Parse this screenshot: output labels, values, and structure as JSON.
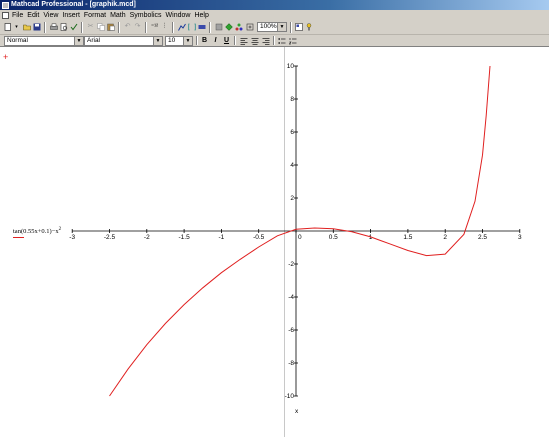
{
  "window": {
    "title": "Mathcad Professional - [graphik.mcd]"
  },
  "menu": {
    "items": [
      "File",
      "Edit",
      "View",
      "Insert",
      "Format",
      "Math",
      "Symbolics",
      "Window",
      "Help"
    ]
  },
  "toolbar": {
    "zoom": "100%"
  },
  "format_bar": {
    "style": "Normal",
    "font": "Arial",
    "size": "10",
    "bold": "B",
    "italic": "I",
    "underline": "U"
  },
  "plot": {
    "legend": "tan(0.55x+0.1)−x",
    "legend_exp": "2",
    "axis_var": "x",
    "x_ticks": [
      "-3",
      "-2.5",
      "-2",
      "-1.5",
      "-1",
      "-0.5",
      "0",
      "0.5",
      "1",
      "1.5",
      "2",
      "2.5",
      "3"
    ],
    "y_ticks": [
      "10",
      "8",
      "6",
      "4",
      "2",
      "-2",
      "-4",
      "-6",
      "-8",
      "-10"
    ],
    "curve_color": "#e02020"
  },
  "chart_data": {
    "type": "line",
    "series": [
      {
        "name": "tan(0.55x+0.1)−x^2",
        "x": [
          -2.5,
          -2.25,
          -2.0,
          -1.75,
          -1.5,
          -1.25,
          -1.0,
          -0.75,
          -0.5,
          -0.25,
          0.0,
          0.25,
          0.5,
          0.75,
          1.0,
          1.25,
          1.5,
          1.75,
          2.0,
          2.25,
          2.4,
          2.5,
          2.55,
          2.6
        ],
        "y": [
          -10.0,
          -8.35,
          -6.89,
          -5.6,
          -4.46,
          -3.44,
          -2.53,
          -1.72,
          -0.97,
          -0.29,
          0.1,
          0.18,
          0.14,
          -0.05,
          -0.36,
          -0.77,
          -1.18,
          -1.49,
          -1.4,
          -0.2,
          1.8,
          4.6,
          7.0,
          10.0
        ]
      }
    ],
    "xlim": [
      -3,
      3
    ],
    "ylim": [
      -10,
      10
    ],
    "grid": false
  }
}
